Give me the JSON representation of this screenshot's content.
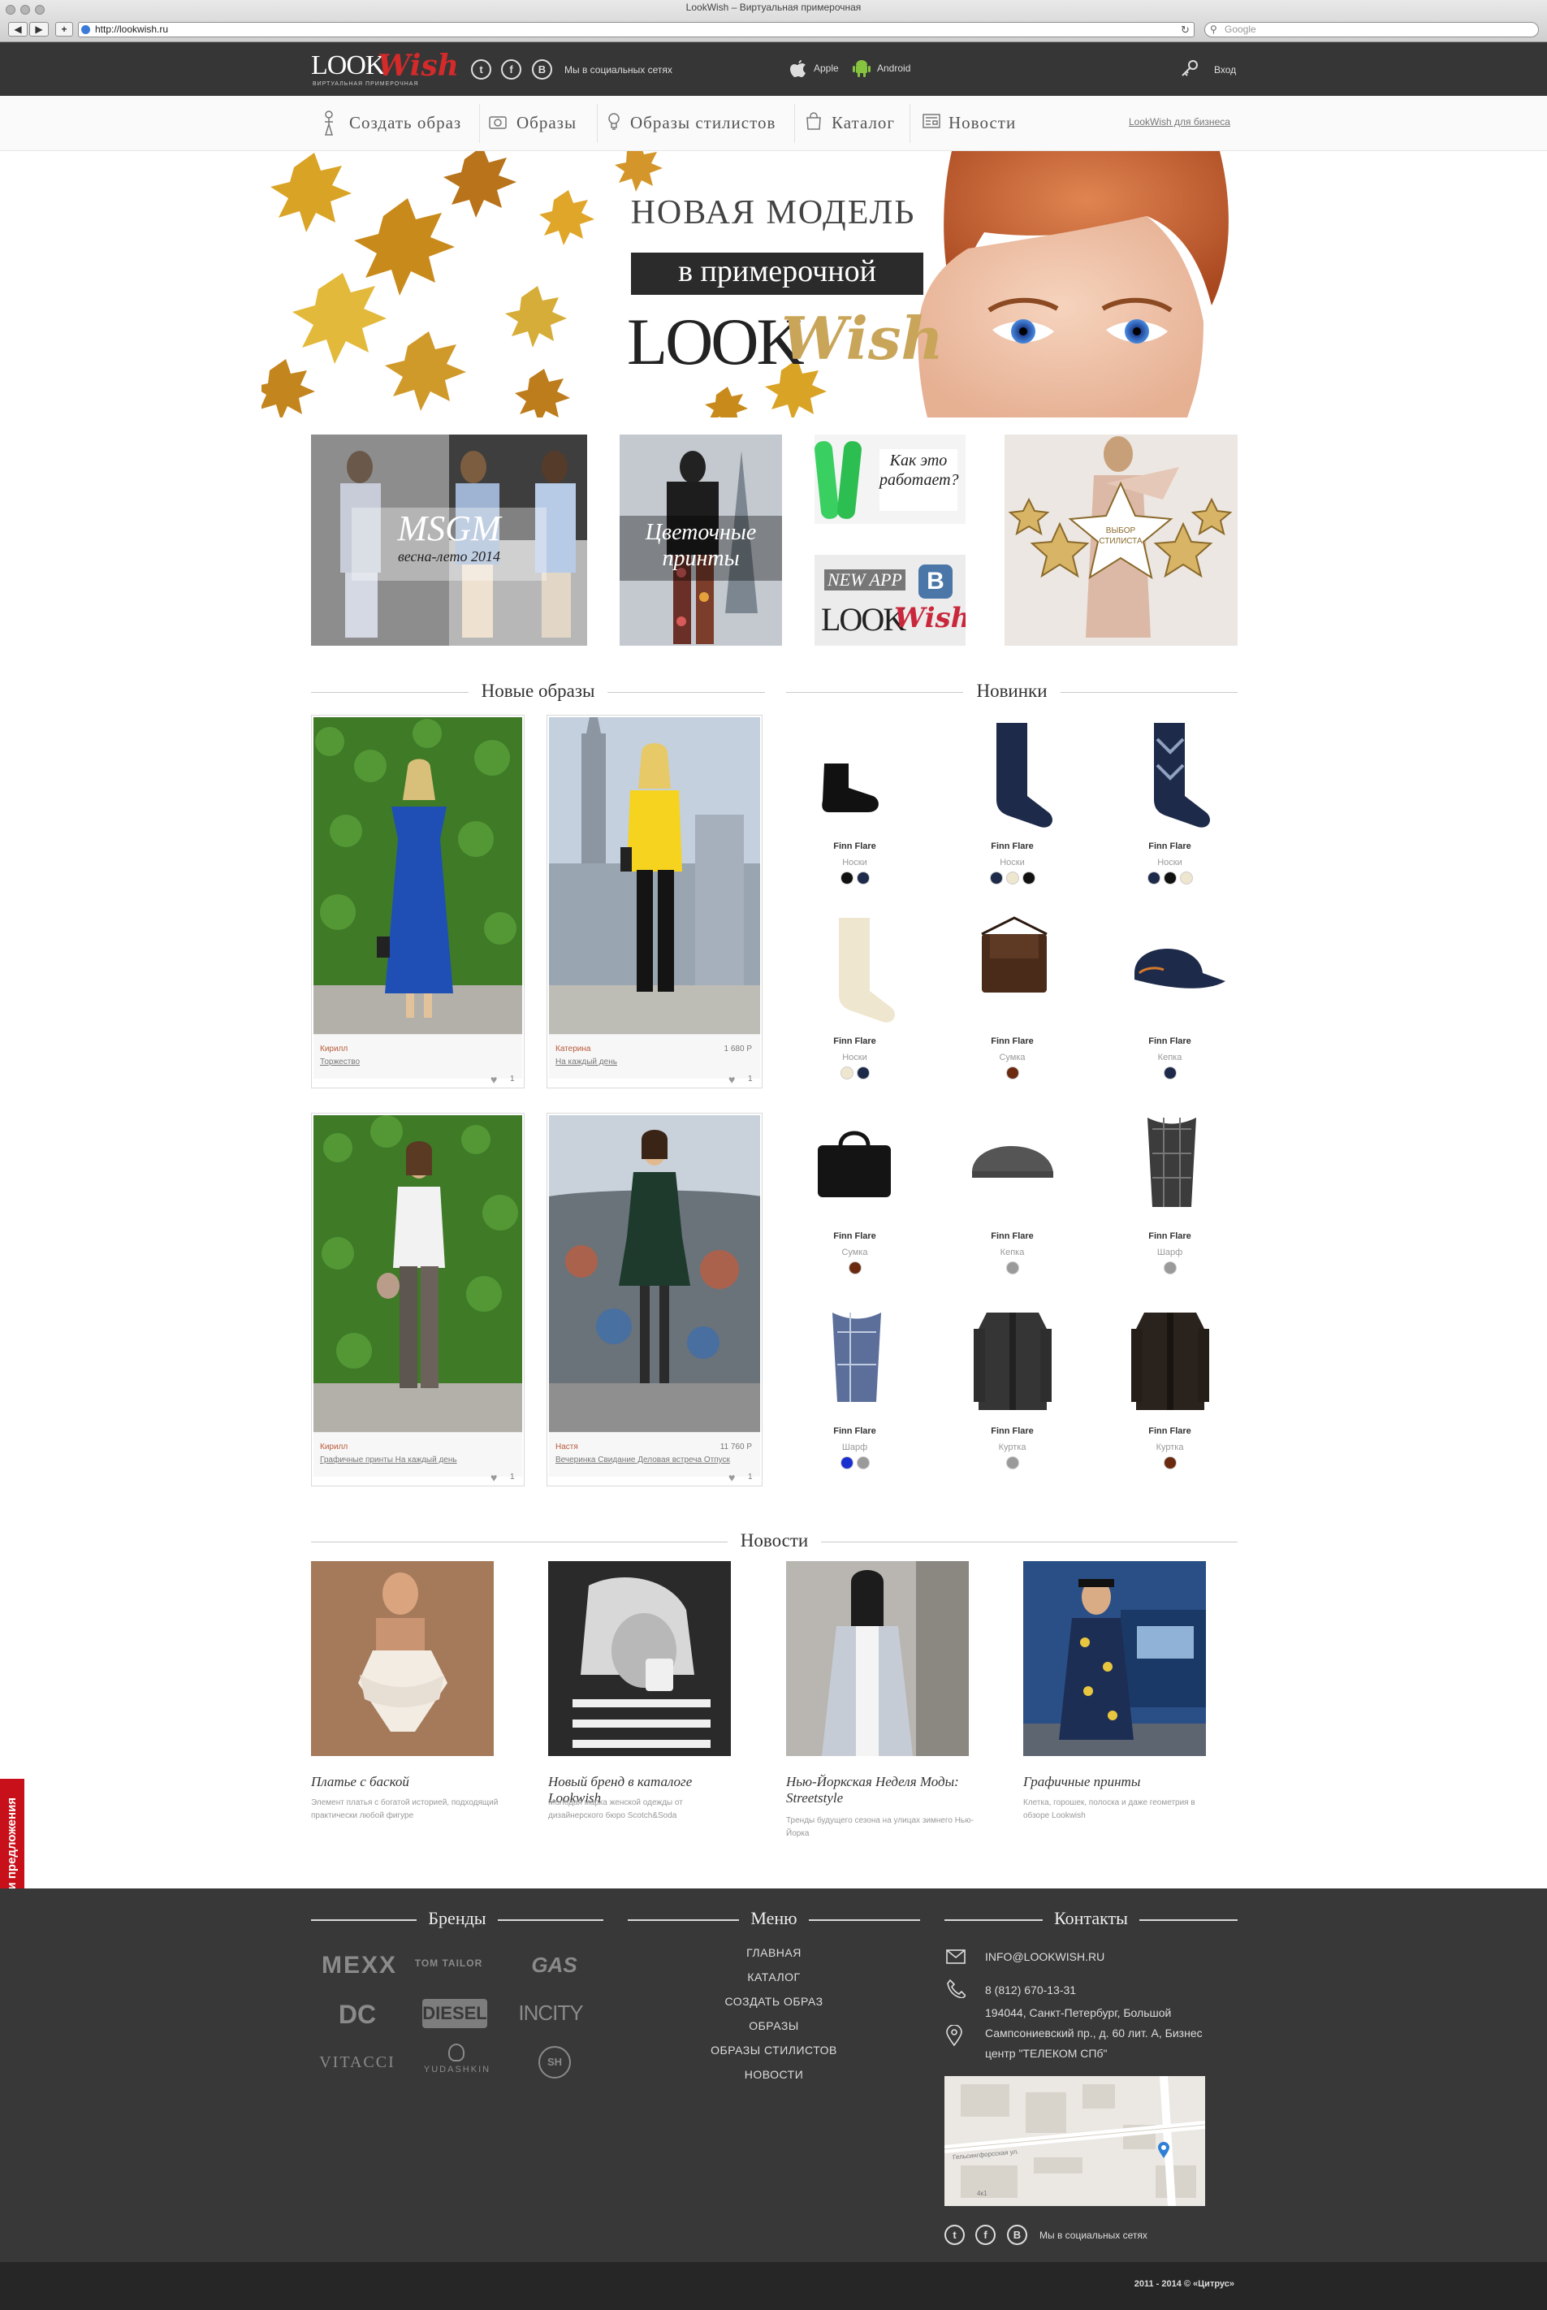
{
  "browser": {
    "window_title": "LookWish – Виртуальная примерочная",
    "url": "http://lookwish.ru",
    "search_placeholder": "Google",
    "back": "◀",
    "forward": "▶",
    "add": "+"
  },
  "header": {
    "logo_look": "LOOK",
    "logo_wish": "Wish",
    "logo_sub": "ВИРТУАЛЬНАЯ ПРИМЕРОЧНАЯ",
    "social_label": "Мы в социальных сетях",
    "apple_label": "Apple",
    "android_label": "Android",
    "login_label": "Вход",
    "social": {
      "twitter": "t",
      "facebook": "f",
      "vk": "В"
    }
  },
  "nav": {
    "items": [
      "Создать образ",
      "Образы",
      "Образы стилистов",
      "Каталог",
      "Новости"
    ],
    "business_link": "LookWish для бизнеса"
  },
  "hero": {
    "line1": "НОВАЯ МОДЕЛЬ",
    "line2": "в примерочной",
    "logo_look": "LOOK",
    "logo_wish": "Wish"
  },
  "promos": {
    "msgm_title": "MSGM",
    "msgm_sub": "весна-лето 2014",
    "prints_title": "Цветочные принты",
    "how_title": "Как это работает?",
    "newapp_label": "NEW APP",
    "newapp_vk": "B",
    "newapp_look": "LOOK",
    "newapp_wish": "Wish",
    "stylist_choice": "ВЫБОР СТИЛИСТА"
  },
  "sections": {
    "new_looks": "Новые образы",
    "new_items": "Новинки",
    "news": "Новости"
  },
  "looks": [
    {
      "author": "Кирилл",
      "tags": "Торжество",
      "price": "",
      "likes": "1"
    },
    {
      "author": "Катерина",
      "tags": "На каждый день",
      "price": "1 680 Р",
      "likes": "1"
    },
    {
      "author": "Кирилл",
      "tags": "Графичные принты На каждый день",
      "price": "",
      "likes": "1"
    },
    {
      "author": "Настя",
      "tags": "Вечеринка Свидание Деловая встреча Отпуск",
      "price": "11 760 Р",
      "likes": "1"
    }
  ],
  "products": [
    {
      "brand": "Finn Flare",
      "category": "Носки",
      "swatches": [
        "#111111",
        "#1d2a4a"
      ]
    },
    {
      "brand": "Finn Flare",
      "category": "Носки",
      "swatches": [
        "#1d2a4a",
        "#efe6cf",
        "#111111"
      ]
    },
    {
      "brand": "Finn Flare",
      "category": "Носки",
      "swatches": [
        "#1d2a4a",
        "#111111",
        "#efe6cf"
      ]
    },
    {
      "brand": "Finn Flare",
      "category": "Носки",
      "swatches": [
        "#efe6cf",
        "#1d2a4a"
      ]
    },
    {
      "brand": "Finn Flare",
      "category": "Сумка",
      "swatches": [
        "#6b2a10"
      ]
    },
    {
      "brand": "Finn Flare",
      "category": "Кепка",
      "swatches": [
        "#1d2a4a"
      ]
    },
    {
      "brand": "Finn Flare",
      "category": "Сумка",
      "swatches": [
        "#6b2a10"
      ]
    },
    {
      "brand": "Finn Flare",
      "category": "Кепка",
      "swatches": [
        "#9a9a9a"
      ]
    },
    {
      "brand": "Finn Flare",
      "category": "Шарф",
      "swatches": [
        "#9a9a9a"
      ]
    },
    {
      "brand": "Finn Flare",
      "category": "Шарф",
      "swatches": [
        "#1a2fd0",
        "#9a9a9a"
      ]
    },
    {
      "brand": "Finn Flare",
      "category": "Куртка",
      "swatches": [
        "#9a9a9a"
      ]
    },
    {
      "brand": "Finn Flare",
      "category": "Куртка",
      "swatches": [
        "#6b2a10"
      ]
    }
  ],
  "news": [
    {
      "title": "Платье с баской",
      "desc": "Элемент платья с богатой историей, подходящий практически любой фигуре"
    },
    {
      "title": "Новый бренд в каталоге Lookwish",
      "desc": "Молодая марка женской одежды от дизайнерского бюро Scotch&Soda"
    },
    {
      "title": "Нью-Йоркская Неделя Моды: Streetstyle",
      "desc": "Тренды будущего сезона на улицах зимнего Нью-Йорка"
    },
    {
      "title": "Графичные принты",
      "desc": "Клетка, горошек, полоска и даже геометрия в обзоре Lookwish"
    }
  ],
  "feedback_tab": "Отзывы и предложения",
  "footer": {
    "brands_title": "Бренды",
    "menu_title": "Меню",
    "contacts_title": "Контакты",
    "brands": [
      "MEXX",
      "TOM TAILOR",
      "GAS",
      "DC",
      "DIESEL",
      "INCITY",
      "VITACCI",
      "YUDASHKIN",
      "SH"
    ],
    "menu": [
      "ГЛАВНАЯ",
      "КАТАЛОГ",
      "СОЗДАТЬ ОБРАЗ",
      "ОБРАЗЫ",
      "ОБРАЗЫ СТИЛИСТОВ",
      "НОВОСТИ"
    ],
    "email": "INFO@LOOKWISH.RU",
    "phone": "8 (812) 670-13-31",
    "address": "194044, Санкт-Петербург, Большой Сампсониевский пр., д. 60 лит. А, Бизнес центр \"ТЕЛЕКОМ СПб\"",
    "map_street": "Гельсингфорсская ул.",
    "map_num": "4к1",
    "social_label": "Мы в социальных сетях",
    "copyright": "2011 - 2014 © «Цитрус»"
  }
}
